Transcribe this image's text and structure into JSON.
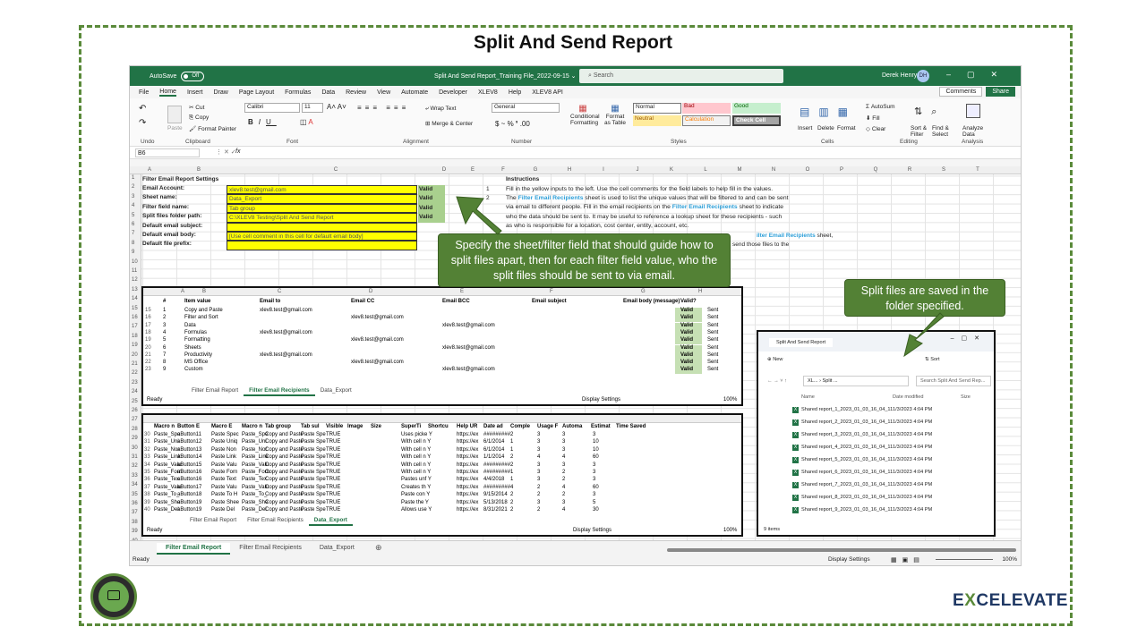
{
  "title": "Split And Send Report",
  "excel": {
    "autosave": "AutoSave",
    "autosave_state": "Off",
    "filename": "Split And Send Report_Training File_2022-09-15 ⌄",
    "search": "Search",
    "user": "Derek Henry",
    "user_initials": "DH",
    "menu": [
      "File",
      "Home",
      "Insert",
      "Draw",
      "Page Layout",
      "Formulas",
      "Data",
      "Review",
      "View",
      "Automate",
      "Developer",
      "XLEV8",
      "Help",
      "XLEV8 API"
    ],
    "comments": "Comments",
    "share": "Share",
    "ribbon": {
      "undo": "Undo",
      "clipboard": "Clipboard",
      "cut": "Cut",
      "copy": "Copy",
      "paste": "Paste",
      "format_painter": "Format Painter",
      "font_name": "Calibri",
      "font_size": "11",
      "font": "Font",
      "wrap": "Wrap Text",
      "merge": "Merge & Center",
      "alignment": "Alignment",
      "numfmt": "General",
      "number": "Number",
      "cond": "Conditional Formatting",
      "fmt_table": "Format as Table",
      "normal": "Normal",
      "bad": "Bad",
      "good": "Good",
      "neutral": "Neutral",
      "calculation": "Calculation",
      "check_cell": "Check Cell",
      "styles": "Styles",
      "insert": "Insert",
      "delete": "Delete",
      "format": "Format",
      "cells": "Cells",
      "autosum": "AutoSum",
      "fill": "Fill",
      "clear": "Clear",
      "sort": "Sort & Filter",
      "find": "Find & Select",
      "editing": "Editing",
      "analyze": "Analyze Data",
      "analysis": "Analysis"
    },
    "namebox": "B6",
    "fx": "fx",
    "cols": [
      "A",
      "B",
      "C",
      "D",
      "E",
      "F",
      "G",
      "H",
      "I",
      "J",
      "K",
      "L",
      "M",
      "N",
      "O",
      "P",
      "Q",
      "R",
      "S",
      "T"
    ],
    "settings": {
      "header": "Filter Email Report Settings",
      "labels": [
        "Email Account:",
        "Sheet name:",
        "Filter field name:",
        "Split files folder path:",
        "Default email subject:",
        "Default email body:",
        "Default file prefix:"
      ],
      "values": [
        "xlev8.test@gmail.com",
        "Data_Export",
        "Tab group",
        "C:\\XLEV8 Testing\\Split And Send Report",
        "",
        "[Use cell comment in this cell for default email body]",
        ""
      ],
      "valid": [
        "Valid",
        "Valid",
        "Valid",
        "Valid"
      ]
    },
    "instructions": {
      "header": "Instructions",
      "n1": "1",
      "n2": "2",
      "l1": "Fill in the yellow inputs to the left.  Use the cell comments for the field labels to help fill in the values.",
      "l2a": "The ",
      "l2b": "Filter Email Recipients",
      "l2c": " sheet is used to list the unique values that will be filtered to and can be sent",
      "l3": "via email to different people.  Fill in the email recipients on the ",
      "l3b": "Filter Email Recipients",
      "l3c": " sheet to indicate",
      "l4": "who the data should be sent to.  It may be useful to reference a lookup sheet for these recipients - such",
      "l5": "as who is responsible for a location, cost center, entity, account, etc.",
      "l6b": "ilter Email Recipients",
      "l6c": " sheet,",
      "l7": "send those files to the"
    },
    "tabs": [
      "Filter Email Report",
      "Filter Email Recipients",
      "Data_Export"
    ],
    "status": "Ready",
    "display": "Display Settings",
    "zoom": "100%"
  },
  "inset1": {
    "headers": [
      "#",
      "Item value",
      "Email to",
      "Email CC",
      "Email BCC",
      "Email subject",
      "Email body (message)",
      "Valid?"
    ],
    "rows": [
      [
        "1",
        "Copy and Paste",
        "xlev8.test@gmail.com",
        "",
        "",
        "",
        "",
        "Valid",
        "Sent"
      ],
      [
        "2",
        "Filter and Sort",
        "",
        "xlev8.test@gmail.com",
        "",
        "",
        "",
        "Valid",
        "Sent"
      ],
      [
        "3",
        "Data",
        "",
        "",
        "xlev8.test@gmail.com",
        "",
        "",
        "Valid",
        "Sent"
      ],
      [
        "4",
        "Formulas",
        "xlev8.test@gmail.com",
        "",
        "",
        "",
        "",
        "Valid",
        "Sent"
      ],
      [
        "5",
        "Formatting",
        "",
        "xlev8.test@gmail.com",
        "",
        "",
        "",
        "Valid",
        "Sent"
      ],
      [
        "6",
        "Sheets",
        "",
        "",
        "xlev8.test@gmail.com",
        "",
        "",
        "Valid",
        "Sent"
      ],
      [
        "7",
        "Productivity",
        "xlev8.test@gmail.com",
        "",
        "",
        "",
        "",
        "Valid",
        "Sent"
      ],
      [
        "8",
        "MS Office",
        "",
        "xlev8.test@gmail.com",
        "",
        "",
        "",
        "Valid",
        "Sent"
      ],
      [
        "9",
        "Custom",
        "",
        "",
        "xlev8.test@gmail.com",
        "",
        "",
        "Valid",
        "Sent"
      ]
    ],
    "tabs": [
      "Filter Email Report",
      "Filter Email Recipients",
      "Data_Export"
    ],
    "status": "Ready",
    "display": "Display Settings",
    "zoom": "100%"
  },
  "inset2": {
    "headers": [
      "Macro n",
      "Button E",
      "Macro E",
      "Macro n",
      "Tab group",
      "Tab sul",
      "Visible",
      "Image",
      "Size",
      "SuperTi",
      "Shortcu",
      "Help UR",
      "Date ad",
      "Comple",
      "Usage F",
      "Automa",
      "Estimat",
      "Time Saved"
    ],
    "rows": [
      [
        "Paste_Spe",
        "aButton11",
        "Paste Spec",
        "Paste_Spe",
        "Copy and Paste",
        "Paste Spe",
        "TRUE",
        "",
        "",
        "Uses picke Y",
        "",
        "https://ex",
        "#########",
        "2",
        "3",
        "3",
        "3"
      ],
      [
        "Paste_Uni",
        "aButton12",
        "Paste Uniq",
        "Paste_Uni",
        "Copy and Paste",
        "Paste Spe",
        "TRUE",
        "",
        "",
        "With cell n Y",
        "",
        "https://ex",
        "6/1/2014",
        "1",
        "3",
        "3",
        "10"
      ],
      [
        "Paste_Nor",
        "aButton13",
        "Paste Non",
        "Paste_Nor",
        "Copy and Paste",
        "Paste Spe",
        "TRUE",
        "",
        "",
        "With cell n Y",
        "",
        "https://ex",
        "6/1/2014",
        "1",
        "3",
        "3",
        "10"
      ],
      [
        "Paste_Link",
        "aButton14",
        "Paste Link",
        "Paste_Link",
        "Copy and Paste",
        "Paste Spe",
        "TRUE",
        "",
        "",
        "With cell n Y",
        "",
        "https://ex",
        "1/1/2014",
        "2",
        "4",
        "4",
        "60"
      ],
      [
        "Paste_Valu",
        "aButton15",
        "Paste Valu",
        "Paste_Valu",
        "Copy and Paste",
        "Paste Spe",
        "TRUE",
        "",
        "",
        "With cell n Y",
        "",
        "https://ex",
        "#########",
        "2",
        "3",
        "3",
        "3"
      ],
      [
        "Paste_Forn",
        "aButton16",
        "Paste Forn",
        "Paste_Forn",
        "Copy and Paste",
        "Paste Spe",
        "TRUE",
        "",
        "",
        "With cell n Y",
        "",
        "https://ex",
        "#########",
        "1",
        "3",
        "2",
        "3"
      ],
      [
        "Paste_Tex",
        "aButton16",
        "Paste Text",
        "Paste_Tex",
        "Copy and Paste",
        "Paste Spe",
        "TRUE",
        "",
        "",
        "Pastes unf Y",
        "",
        "https://ex",
        "4/4/2018",
        "1",
        "3",
        "2",
        "3"
      ],
      [
        "Paste_Valu",
        "aButton17",
        "Paste Valu",
        "Paste_Valu",
        "Copy and Paste",
        "Paste Spe",
        "TRUE",
        "",
        "",
        "Creates th Y",
        "",
        "https://ex",
        "#########",
        "4",
        "2",
        "4",
        "60"
      ],
      [
        "Paste_To_",
        "aButton18",
        "Paste To H",
        "Paste_To_",
        "Copy and Paste",
        "Paste Spe",
        "TRUE",
        "",
        "",
        "Paste con Y",
        "",
        "https://ex",
        "9/15/2014",
        "2",
        "2",
        "2",
        "3"
      ],
      [
        "Paste_She",
        "aButton19",
        "Paste Shee",
        "Paste_She",
        "Copy and Paste",
        "Paste Spe",
        "TRUE",
        "",
        "",
        "Paste the Y",
        "",
        "https://ex",
        "5/13/2018",
        "2",
        "3",
        "3",
        "5"
      ],
      [
        "Paste_Del",
        "aButton19",
        "Paste Del",
        "Paste_Del",
        "Copy and Paste",
        "Paste Spe",
        "TRUE",
        "",
        "",
        "Allows use Y",
        "",
        "https://ex",
        "8/31/2021",
        "2",
        "2",
        "4",
        "30"
      ]
    ],
    "tabs": [
      "Filter Email Report",
      "Filter Email Recipients",
      "Data_Export"
    ],
    "status": "Ready",
    "display": "Display Settings",
    "zoom": "100%"
  },
  "callout1": "Specify the sheet/filter field that should guide how to split files apart, then for each filter field value, who the split files should be sent to via email.",
  "callout2": "Split files are saved in the folder specified.",
  "explorer": {
    "tab": "Split And Send Report",
    "new": "New",
    "sort": "Sort",
    "path1": "XL...",
    "path2": "Split ...",
    "search": "Search Split And Send Rep...",
    "col_name": "Name",
    "col_date": "Date modified",
    "col_size": "Size",
    "files": [
      {
        "name": "Shared report_1_2023_01_03_16_04_11",
        "date": "1/3/2023 4:04 PM"
      },
      {
        "name": "Shared report_2_2023_01_03_16_04_11",
        "date": "1/3/2023 4:04 PM"
      },
      {
        "name": "Shared report_3_2023_01_03_16_04_11",
        "date": "1/3/2023 4:04 PM"
      },
      {
        "name": "Shared report_4_2023_01_03_16_04_11",
        "date": "1/3/2023 4:04 PM"
      },
      {
        "name": "Shared report_5_2023_01_03_16_04_11",
        "date": "1/3/2023 4:04 PM"
      },
      {
        "name": "Shared report_6_2023_01_03_16_04_11",
        "date": "1/3/2023 4:04 PM"
      },
      {
        "name": "Shared report_7_2023_01_03_16_04_11",
        "date": "1/3/2023 4:04 PM"
      },
      {
        "name": "Shared report_8_2023_01_03_16_04_11",
        "date": "1/3/2023 4:04 PM"
      },
      {
        "name": "Shared report_9_2023_01_03_16_04_11",
        "date": "1/3/2023 4:04 PM"
      }
    ],
    "count": "9 items"
  },
  "logo": {
    "pre": "E",
    "x": "X",
    "post": "CELEVATE"
  },
  "colors": {
    "accent": "#217346",
    "callout": "#538135",
    "frame": "#5a8a3a"
  }
}
